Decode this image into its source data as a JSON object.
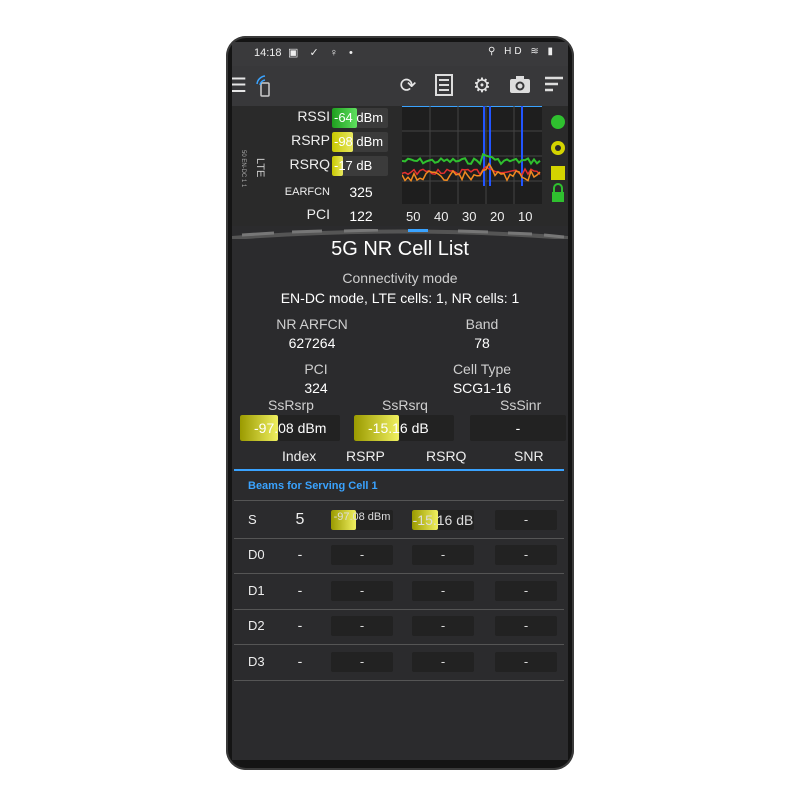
{
  "status": {
    "time": "14:18",
    "left_icons": "▣ ✓ ♀ •",
    "right_icons": "⚲ HD ≋ ▮"
  },
  "measurements": [
    {
      "label": "RSSI",
      "value": "-64 dBm",
      "level": 0.45,
      "color": "#2fc02f"
    },
    {
      "label": "RSRP",
      "value": "-98 dBm",
      "level": 0.38,
      "color": "#c8c800"
    },
    {
      "label": "RSRQ",
      "value": "-17 dB",
      "level": 0.2,
      "color": "#c8c800"
    },
    {
      "label": "EARFCN",
      "value": "325",
      "level": 0,
      "color": ""
    },
    {
      "label": "PCI",
      "value": "122",
      "level": 0,
      "color": ""
    }
  ],
  "graph_axis": [
    "50",
    "40",
    "30",
    "20",
    "10"
  ],
  "lte_label": "LTE",
  "lte_small": "50 EN-DC 1 1",
  "title": "5G NR Cell List",
  "connectivity": {
    "label": "Connectivity mode",
    "value": "EN-DC mode, LTE cells: 1, NR cells: 1"
  },
  "nr_arfcn": {
    "label": "NR ARFCN",
    "value": "627264"
  },
  "band": {
    "label": "Band",
    "value": "78"
  },
  "pci": {
    "label": "PCI",
    "value": "324"
  },
  "cell_type": {
    "label": "Cell Type",
    "value": "SCG1-16"
  },
  "ss": [
    {
      "label": "SsRsrp",
      "value": "-97.08 dBm",
      "level": 0.38
    },
    {
      "label": "SsRsrq",
      "value": "-15.16 dB",
      "level": 0.45
    },
    {
      "label": "SsSinr",
      "value": "-",
      "level": 0
    }
  ],
  "beam_headers": [
    "Index",
    "RSRP",
    "RSRQ",
    "SNR"
  ],
  "beams_title": "Beams for Serving Cell 1",
  "beams": [
    {
      "label": "S",
      "index": "5",
      "rsrp": "-97.08 dBm",
      "rsrp_level": 0.4,
      "rsrq": "-15.16 dB",
      "rsrq_level": 0.42,
      "snr": "-"
    },
    {
      "label": "D0",
      "index": "-",
      "rsrp": "-",
      "rsrp_level": 0,
      "rsrq": "-",
      "rsrq_level": 0,
      "snr": "-"
    },
    {
      "label": "D1",
      "index": "-",
      "rsrp": "-",
      "rsrp_level": 0,
      "rsrq": "-",
      "rsrq_level": 0,
      "snr": "-"
    },
    {
      "label": "D2",
      "index": "-",
      "rsrp": "-",
      "rsrp_level": 0,
      "rsrq": "-",
      "rsrq_level": 0,
      "snr": "-"
    },
    {
      "label": "D3",
      "index": "-",
      "rsrp": "-",
      "rsrp_level": 0,
      "rsrq": "-",
      "rsrq_level": 0,
      "snr": "-"
    }
  ],
  "toolbar_icons": [
    "menu-icon",
    "signal-phone-icon",
    "refresh-icon",
    "log-icon",
    "settings-icon",
    "camera-icon",
    "sort-icon"
  ],
  "colors": {
    "yellow": "#d4d400",
    "green": "#2fc02f",
    "accent": "#3aa3ff"
  }
}
